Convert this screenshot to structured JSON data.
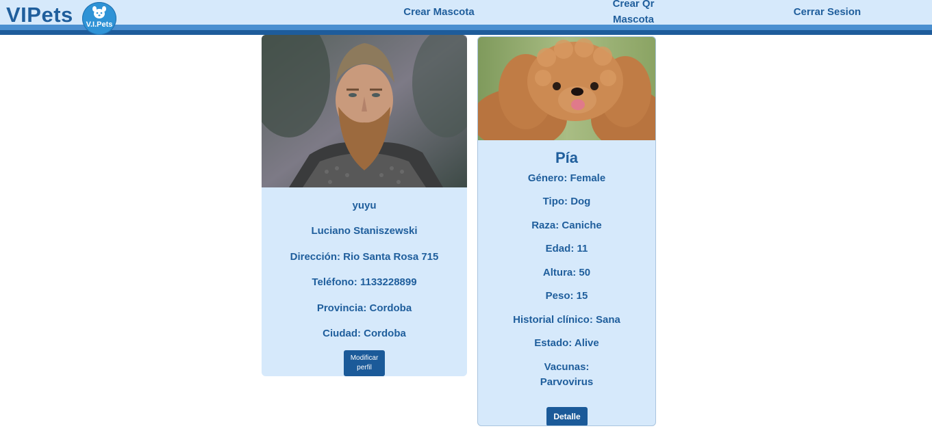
{
  "header": {
    "brand": "VIPets",
    "logo_text": "V.I.Pets",
    "nav": {
      "create_pet": "Crear Mascota",
      "create_qr_line1": "Crear Qr",
      "create_qr_line2": "Mascota",
      "logout": "Cerrar Sesion"
    },
    "colors": {
      "bar": "#d6e9fb",
      "stripe_light": "#4a8fd0",
      "stripe_dark": "#1e5c9b",
      "text": "#1f5e9c"
    }
  },
  "user": {
    "username": "yuyu",
    "full_name": "Luciano Staniszewski",
    "address": "Dirección: Rio Santa Rosa 715",
    "phone": "Teléfono: 1133228899",
    "province": "Provincia: Cordoba",
    "city": "Ciudad: Cordoba",
    "button_line1": "Modificar",
    "button_line2": "perfil"
  },
  "pet": {
    "name": "Pía",
    "gender": "Género: Female",
    "type": "Tipo: Dog",
    "breed": "Raza: Caniche",
    "age": "Edad: 11",
    "height": "Altura: 50",
    "weight": "Peso: 15",
    "history": "Historial clínico: Sana",
    "status": "Estado: Alive",
    "vaccines_label": "Vacunas:",
    "vaccines": "Parvovirus",
    "button": "Detalle"
  }
}
